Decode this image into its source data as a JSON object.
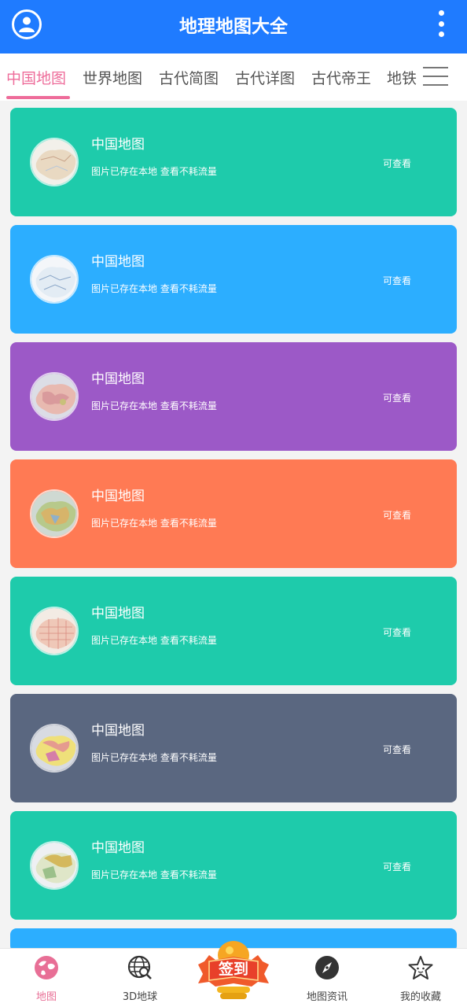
{
  "app": {
    "title": "地理地图大全"
  },
  "tabs": [
    {
      "label": "中国地图",
      "active": true
    },
    {
      "label": "世界地图"
    },
    {
      "label": "古代简图"
    },
    {
      "label": "古代详图"
    },
    {
      "label": "古代帝王"
    },
    {
      "label": "地铁"
    }
  ],
  "cards": [
    {
      "title": "中国地图",
      "desc": "图片已存在本地 查看不耗流量",
      "status": "可查看",
      "color": "#1ecbab"
    },
    {
      "title": "中国地图",
      "desc": "图片已存在本地 查看不耗流量",
      "status": "可查看",
      "color": "#2caeff"
    },
    {
      "title": "中国地图",
      "desc": "图片已存在本地 查看不耗流量",
      "status": "可查看",
      "color": "#9c59c7"
    },
    {
      "title": "中国地图",
      "desc": "图片已存在本地 查看不耗流量",
      "status": "可查看",
      "color": "#ff7a54"
    },
    {
      "title": "中国地图",
      "desc": "图片已存在本地 查看不耗流量",
      "status": "可查看",
      "color": "#1ecbab"
    },
    {
      "title": "中国地图",
      "desc": "图片已存在本地 查看不耗流量",
      "status": "可查看",
      "color": "#5a6780"
    },
    {
      "title": "中国地图",
      "desc": "图片已存在本地 查看不耗流量",
      "status": "可查看",
      "color": "#1ecbab"
    }
  ],
  "bottom_nav": [
    {
      "label": "地图",
      "icon": "globe-icon",
      "active": true
    },
    {
      "label": "3D地球",
      "icon": "earth-search-icon"
    },
    {
      "label": "签到",
      "icon": "sign-in-badge-icon"
    },
    {
      "label": "地图资讯",
      "icon": "compass-icon"
    },
    {
      "label": "我的收藏",
      "icon": "star-icon"
    }
  ],
  "colors": {
    "header": "#1f7bff",
    "accent": "#ee6c9a",
    "partial_card": "#2caeff"
  }
}
